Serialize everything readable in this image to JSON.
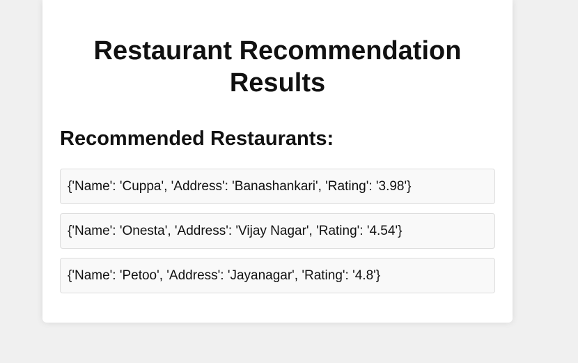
{
  "page": {
    "title": "Restaurant Recommendation Results",
    "subtitle": "Recommended Restaurants:"
  },
  "restaurants": [
    {
      "text": "{'Name': 'Cuppa', 'Address': 'Banashankari', 'Rating': '3.98'}"
    },
    {
      "text": "{'Name': 'Onesta', 'Address': 'Vijay Nagar', 'Rating': '4.54'}"
    },
    {
      "text": "{'Name': 'Petoo', 'Address': 'Jayanagar', 'Rating': '4.8'}"
    }
  ],
  "colors": {
    "background": "#f0f0f0",
    "card": "#ffffff",
    "item_background": "#f9f9f9",
    "item_border": "#dddddd",
    "text": "#111111"
  }
}
